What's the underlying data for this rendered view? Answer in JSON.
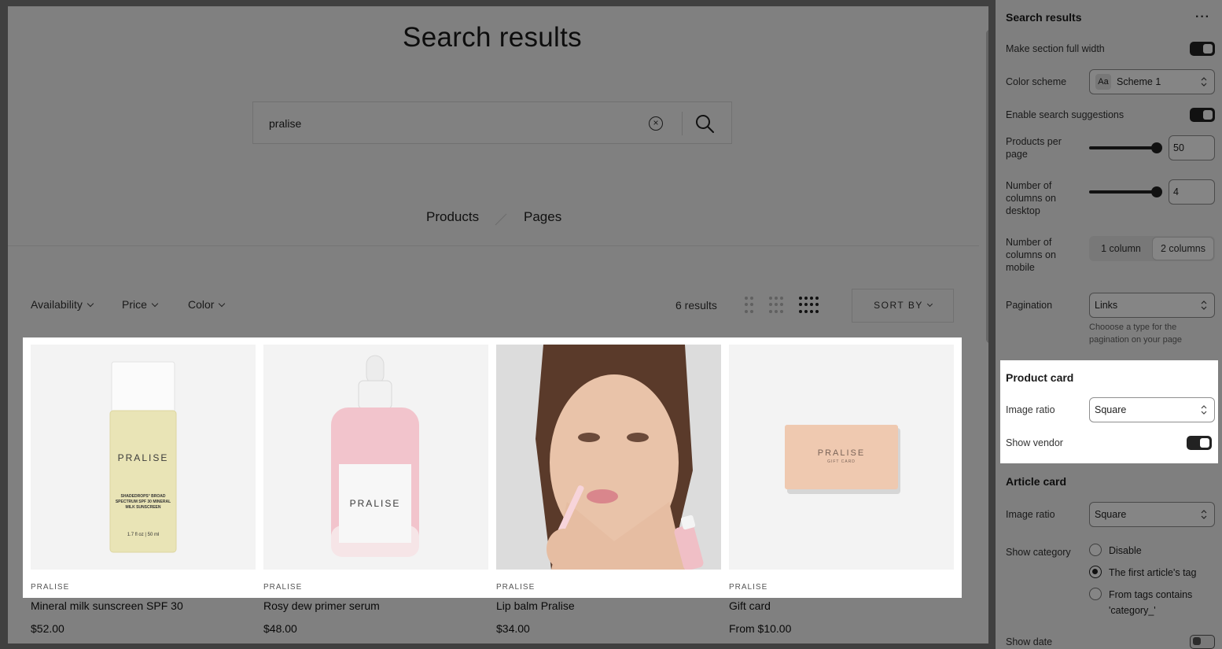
{
  "preview": {
    "title": "Search results",
    "search": {
      "value": "pralise"
    },
    "tabs": [
      {
        "label": "Products"
      },
      {
        "label": "Pages"
      }
    ],
    "filters": [
      {
        "label": "Availability"
      },
      {
        "label": "Price"
      },
      {
        "label": "Color"
      }
    ],
    "results_count": "6 results",
    "sort_label": "SORT BY",
    "products": [
      {
        "vendor": "PRALISE",
        "name": "Mineral milk sunscreen SPF 30",
        "price": "$52.00",
        "image_text": "PRALISE",
        "image_small": "SHADEDROPS° BROAD SPECTRUM SPF 30 MINERAL MILK SUNSCREEN",
        "image_volume": "1.7 fl oz | 50 ml"
      },
      {
        "vendor": "PRALISE",
        "name": "Rosy dew primer serum",
        "price": "$48.00",
        "image_text": "PRALISE"
      },
      {
        "vendor": "PRALISE",
        "name": "Lip balm Pralise",
        "price": "$34.00"
      },
      {
        "vendor": "PRALISE",
        "name": "Gift card",
        "price": "From $10.00",
        "image_text": "PRALISE",
        "image_small": "GIFT CARD"
      }
    ]
  },
  "panel": {
    "title": "Search results",
    "full_width": {
      "label": "Make section full width",
      "on": true
    },
    "color_scheme": {
      "label": "Color scheme",
      "value": "Scheme 1"
    },
    "suggestions": {
      "label": "Enable search suggestions",
      "on": true
    },
    "per_page": {
      "label": "Products per page",
      "value": "50"
    },
    "cols_desktop": {
      "label": "Number of columns on desktop",
      "value": "4"
    },
    "cols_mobile": {
      "label": "Number of columns on mobile",
      "options": [
        "1 column",
        "2 columns"
      ],
      "selected": "2 columns"
    },
    "pagination": {
      "label": "Pagination",
      "value": "Links",
      "help": "Chooose a type for the pagination on your page"
    },
    "product_card": {
      "title": "Product card",
      "ratio_label": "Image ratio",
      "ratio_value": "Square",
      "vendor_label": "Show vendor",
      "vendor_on": true
    },
    "article_card": {
      "title": "Article card",
      "ratio_label": "Image ratio",
      "ratio_value": "Square",
      "category_label": "Show category",
      "category_options": [
        "Disable",
        "The first article's tag",
        "From tags contains 'category_'"
      ],
      "category_selected": "The first article's tag",
      "date_label": "Show date",
      "date_on": false
    }
  }
}
